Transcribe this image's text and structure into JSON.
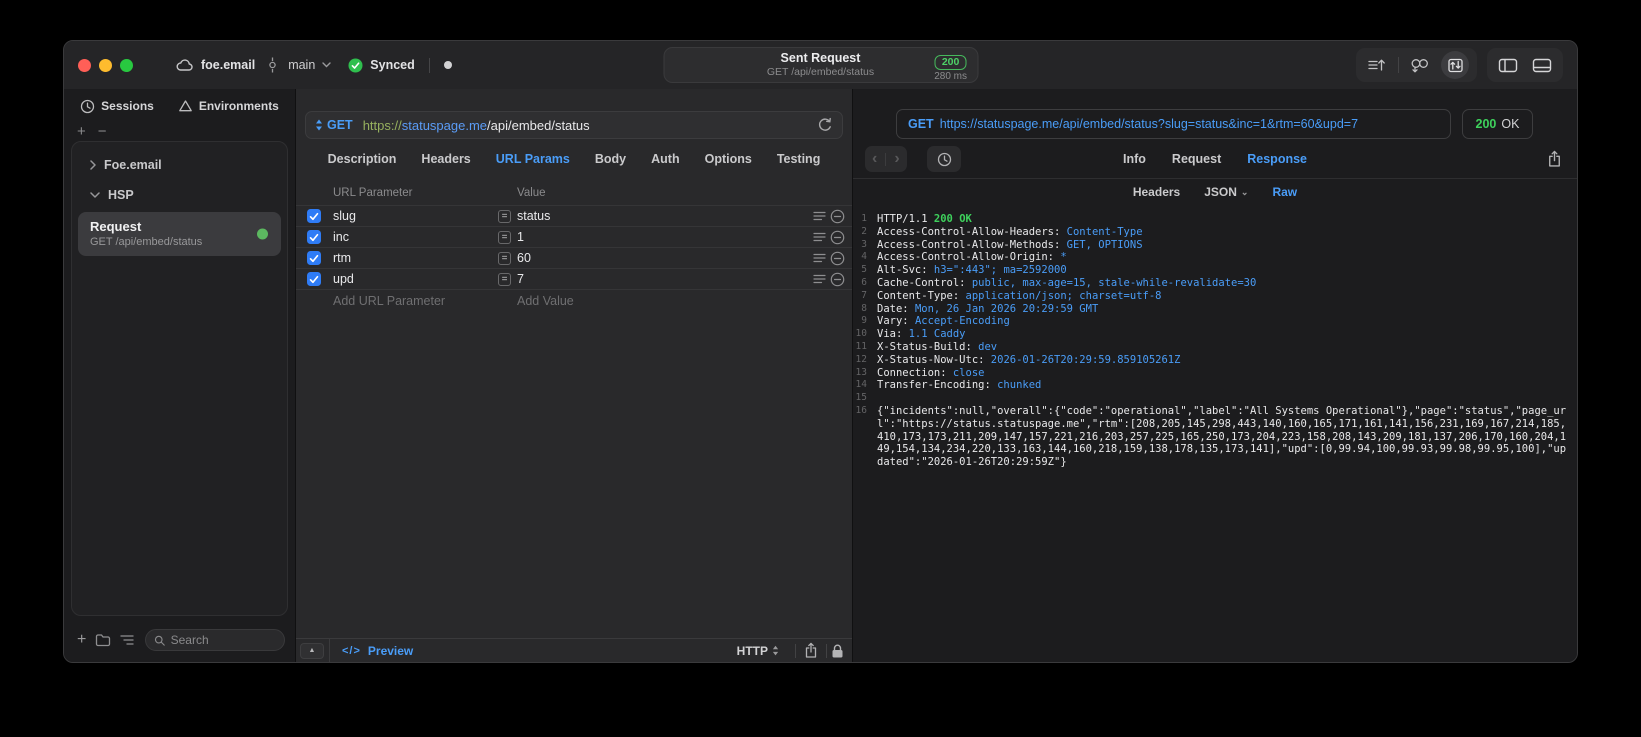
{
  "glyphs": {
    "plus": "+",
    "minus": "−",
    "collapse_up": "▲",
    "code": "</>",
    "back": "‹",
    "forward": "›",
    "caret_down": "⌄",
    "equals": "="
  },
  "titlebar": {
    "project": "foe.email",
    "branch": "main",
    "sync_status": "Synced",
    "request_title": "Sent Request",
    "request_subtitle": "GET /api/embed/status",
    "status_code": "200",
    "duration": "280 ms"
  },
  "sidebar": {
    "tabs": [
      {
        "label": "Sessions"
      },
      {
        "label": "Environments"
      }
    ],
    "tree": {
      "group1": "Foe.email",
      "group2": "HSP",
      "request_name": "Request",
      "request_method_path": "GET /api/embed/status"
    },
    "search_placeholder": "Search"
  },
  "request_pane": {
    "method": "GET",
    "url_scheme": "https://",
    "url_host": "statuspage.me",
    "url_path": "/api/embed/status",
    "tabs": [
      "Description",
      "Headers",
      "URL Params",
      "Body",
      "Auth",
      "Options",
      "Testing"
    ],
    "active_tab": "URL Params",
    "table": {
      "col_param": "URL Parameter",
      "col_value": "Value",
      "rows": [
        {
          "name": "slug",
          "value": "status"
        },
        {
          "name": "inc",
          "value": "1"
        },
        {
          "name": "rtm",
          "value": "60"
        },
        {
          "name": "upd",
          "value": "7"
        }
      ],
      "add_param_placeholder": "Add URL Parameter",
      "add_value_placeholder": "Add Value"
    },
    "footer": {
      "preview_label": "Preview",
      "protocol": "HTTP"
    }
  },
  "response_pane": {
    "method": "GET",
    "request_url": "https://statuspage.me/api/embed/status?slug=status&inc=1&rtm=60&upd=7",
    "status_code": "200",
    "status_text": "OK",
    "tabs": [
      "Info",
      "Request",
      "Response"
    ],
    "active_tab": "Response",
    "subtabs": [
      "Headers",
      "JSON",
      "Raw"
    ],
    "active_subtab": "Raw",
    "headers": [
      {
        "num": "1",
        "key": "HTTP/1.1 ",
        "val": "200 OK"
      },
      {
        "num": "2",
        "key": "Access-Control-Allow-Headers: ",
        "val": "Content-Type"
      },
      {
        "num": "3",
        "key": "Access-Control-Allow-Methods: ",
        "val": "GET, OPTIONS"
      },
      {
        "num": "4",
        "key": "Access-Control-Allow-Origin: ",
        "val": "*"
      },
      {
        "num": "5",
        "key": "Alt-Svc: ",
        "val": "h3=\":443\"; ma=2592000"
      },
      {
        "num": "6",
        "key": "Cache-Control: ",
        "val": "public, max-age=15, stale-while-revalidate=30"
      },
      {
        "num": "7",
        "key": "Content-Type: ",
        "val": "application/json; charset=utf-8"
      },
      {
        "num": "8",
        "key": "Date: ",
        "val": "Mon, 26 Jan 2026 20:29:59 GMT"
      },
      {
        "num": "9",
        "key": "Vary: ",
        "val": "Accept-Encoding"
      },
      {
        "num": "10",
        "key": "Via: ",
        "val": "1.1 Caddy"
      },
      {
        "num": "11",
        "key": "X-Status-Build: ",
        "val": "dev"
      },
      {
        "num": "12",
        "key": "X-Status-Now-Utc: ",
        "val": "2026-01-26T20:29:59.859105261Z"
      },
      {
        "num": "13",
        "key": "Connection: ",
        "val": "close"
      },
      {
        "num": "14",
        "key": "Transfer-Encoding: ",
        "val": "chunked"
      }
    ],
    "blank_line_num": "15",
    "body_line_num": "16",
    "body": "{\"incidents\":null,\"overall\":{\"code\":\"operational\",\"label\":\"All Systems Operational\"},\"page\":\"status\",\"page_url\":\"https://status.statuspage.me\",\"rtm\":[208,205,145,298,443,140,160,165,171,161,141,156,231,169,167,214,185,410,173,173,211,209,147,157,221,216,203,257,225,165,250,173,204,223,158,208,143,209,181,137,206,170,160,204,149,154,134,234,220,133,163,144,160,218,159,138,178,135,173,141],\"upd\":[0,99.94,100,99.93,99.98,99.95,100],\"updated\":\"2026-01-26T20:29:59Z\"}"
  },
  "colors": {
    "accent_blue": "#4a9df8",
    "status_green": "#3ed15c",
    "checkbox_blue": "#2f7cf6",
    "scheme_green": "#96b05e"
  }
}
